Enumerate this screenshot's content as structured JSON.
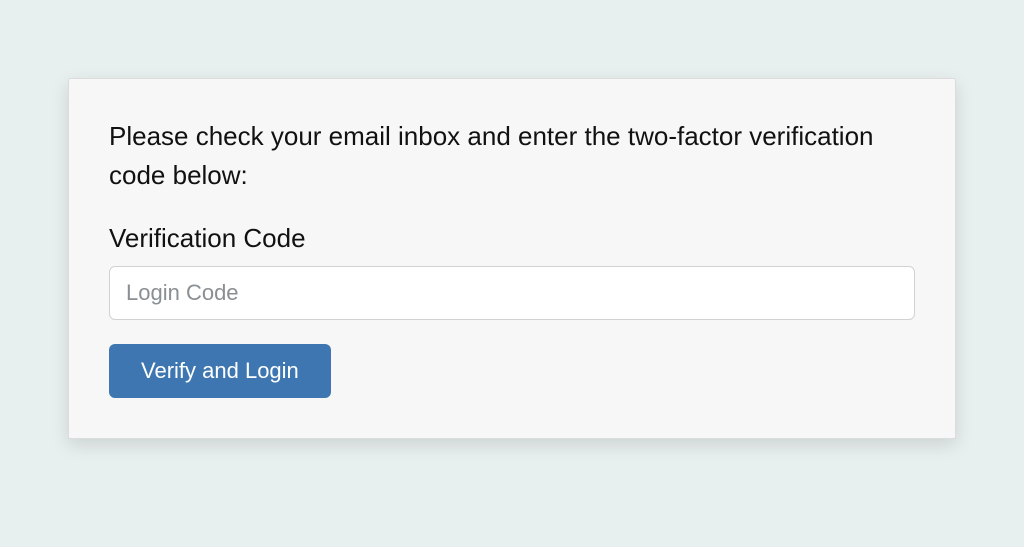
{
  "form": {
    "instruction": "Please check your email inbox and enter the two-factor verification code below:",
    "field_label": "Verification Code",
    "code_placeholder": "Login Code",
    "code_value": "",
    "submit_label": "Verify and Login"
  }
}
